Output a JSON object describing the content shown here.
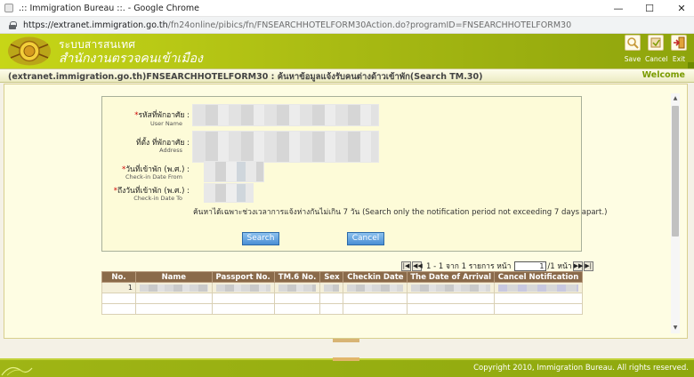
{
  "browser": {
    "window_title": ".:: Immigration Bureau ::. - Google Chrome",
    "url_host": "https://extranet.immigration.go.th",
    "url_path": "/fn24online/pibics/fn/FNSEARCHHOTELFORM30Action.do?programID=FNSEARCHHOTELFORM30",
    "controls": {
      "minimize": "—",
      "maximize": "☐",
      "close": "✕"
    }
  },
  "header": {
    "org_line1": "ระบบสารสนเทศ",
    "org_line2": "สำนักงานตรวจคนเข้าเมือง",
    "toolbar": {
      "save": "Save",
      "cancel": "Cancel",
      "exit": "Exit"
    }
  },
  "form_title": "(extranet.immigration.go.th)FNSEARCHHOTELFORM30 : ค้นหาข้อมูลแจ้งรับคนต่างด้าวเข้าพัก(Search TM.30)",
  "welcome": "Welcome",
  "search_form": {
    "user_name_th": "รหัสที่พักอาศัย :",
    "user_name_en": "User Name",
    "address_th": "ที่ตั้ง ที่พักอาศัย :",
    "address_en": "Address",
    "checkin_from_th": "วันที่เข้าพัก (พ.ศ.) :",
    "checkin_from_en": "Check-in Date From",
    "checkin_to_th": "ถึงวันที่เข้าพัก (พ.ศ.) :",
    "checkin_to_en": "Check-in Date To",
    "required_mark": "*",
    "hint": "ค้นหาได้เฉพาะช่วงเวลาการแจ้งห่างกันไม่เกิน 7 วัน (Search only the notification period not exceeding 7 days apart.)",
    "search_button": "Search",
    "cancel_button": "Cancel"
  },
  "pager": {
    "first": "|◀",
    "prev": "◀◀",
    "summary": "1 - 1 จาก 1 รายการ หน้า",
    "page_value": "1",
    "of_pages": "/1 หน้า",
    "next": "▶▶",
    "last": "▶|"
  },
  "table": {
    "columns": [
      "No.",
      "Name",
      "Passport No.",
      "TM.6 No.",
      "Sex",
      "Checkin Date",
      "The Date of Arrival",
      "Cancel Notification"
    ],
    "rows": [
      {
        "no": "1"
      }
    ]
  },
  "footer": {
    "copyright": "Copyright 2010, Immigration Bureau. All rights reserved."
  }
}
